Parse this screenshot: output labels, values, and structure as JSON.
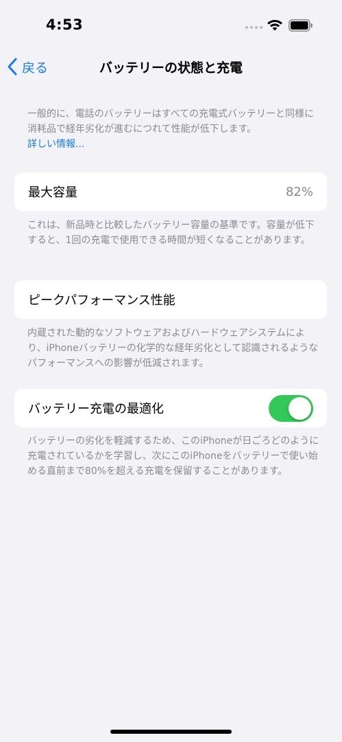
{
  "status_bar": {
    "time": "4:53",
    "icons": [
      "signal-dots-icon",
      "wifi-icon",
      "battery-icon"
    ]
  },
  "nav": {
    "back_label": "戻る",
    "title": "バッテリーの状態と充電"
  },
  "intro": {
    "text": "一般的に、電話のバッテリーはすべての充電式バッテリーと同様に消耗品で経年劣化が進むにつれて性能が低下します。",
    "link": "詳しい情報..."
  },
  "max_capacity": {
    "label": "最大容量",
    "value": "82%",
    "footnote": "これは、新品時と比較したバッテリー容量の基準です。容量が低下すると、1回の充電で使用できる時間が短くなることがあります。"
  },
  "peak_performance": {
    "label": "ピークパフォーマンス性能",
    "footnote": "内蔵された動的なソフトウェアおよびハードウェアシステムにより、iPhoneバッテリーの化学的な経年劣化として認識されるようなパフォーマンスへの影響が低減されます。"
  },
  "optimized_charging": {
    "label": "バッテリー充電の最適化",
    "enabled": true,
    "footnote": "バッテリーの劣化を軽減するため、このiPhoneが日ごろどのように充電されているかを学習し、次にこのiPhoneをバッテリーで使い始める直前まで80%を超える充電を保留することがあります。"
  },
  "colors": {
    "accent": "#1a7ae6",
    "toggle_on": "#34c759",
    "background": "#f2f2f7",
    "secondary_text": "#8a8a8e"
  }
}
